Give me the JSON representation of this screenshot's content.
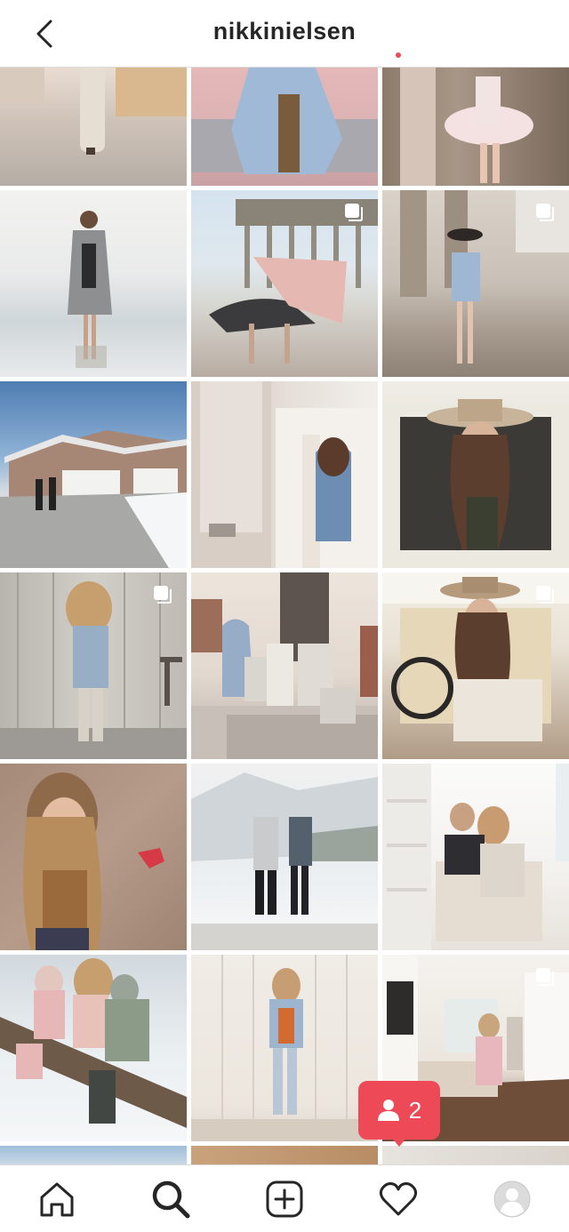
{
  "header": {
    "username": "nikkinielsen",
    "back_icon": "chevron-left-icon"
  },
  "grid": {
    "tiles": [
      {
        "name": "photo-street-walk",
        "multi": false
      },
      {
        "name": "photo-denim-jacket-closeup",
        "multi": false
      },
      {
        "name": "photo-tutu-girl",
        "multi": false
      },
      {
        "name": "photo-beach-kimono",
        "multi": false
      },
      {
        "name": "photo-pier-blanket",
        "multi": true
      },
      {
        "name": "photo-pier-girl-hat",
        "multi": true
      },
      {
        "name": "photo-snow-house",
        "multi": false
      },
      {
        "name": "photo-girl-at-wall",
        "multi": false
      },
      {
        "name": "photo-woman-in-truck",
        "multi": false
      },
      {
        "name": "photo-girl-by-shed",
        "multi": true
      },
      {
        "name": "photo-family-on-steps",
        "multi": false
      },
      {
        "name": "photo-woman-truck-seat",
        "multi": true
      },
      {
        "name": "photo-girl-climbing-wall",
        "multi": false
      },
      {
        "name": "photo-couple-in-snow",
        "multi": false
      },
      {
        "name": "photo-family-on-couch",
        "multi": false
      },
      {
        "name": "photo-kids-on-log",
        "multi": false
      },
      {
        "name": "photo-girl-white-wall",
        "multi": false
      },
      {
        "name": "photo-living-room",
        "multi": true
      }
    ]
  },
  "notification_toast": {
    "icon": "person-icon",
    "count": "2",
    "color": "#ed4956"
  },
  "bottom_nav": {
    "items": [
      "home-icon",
      "search-icon",
      "new-post-icon",
      "activity-icon",
      "profile-avatar"
    ]
  }
}
